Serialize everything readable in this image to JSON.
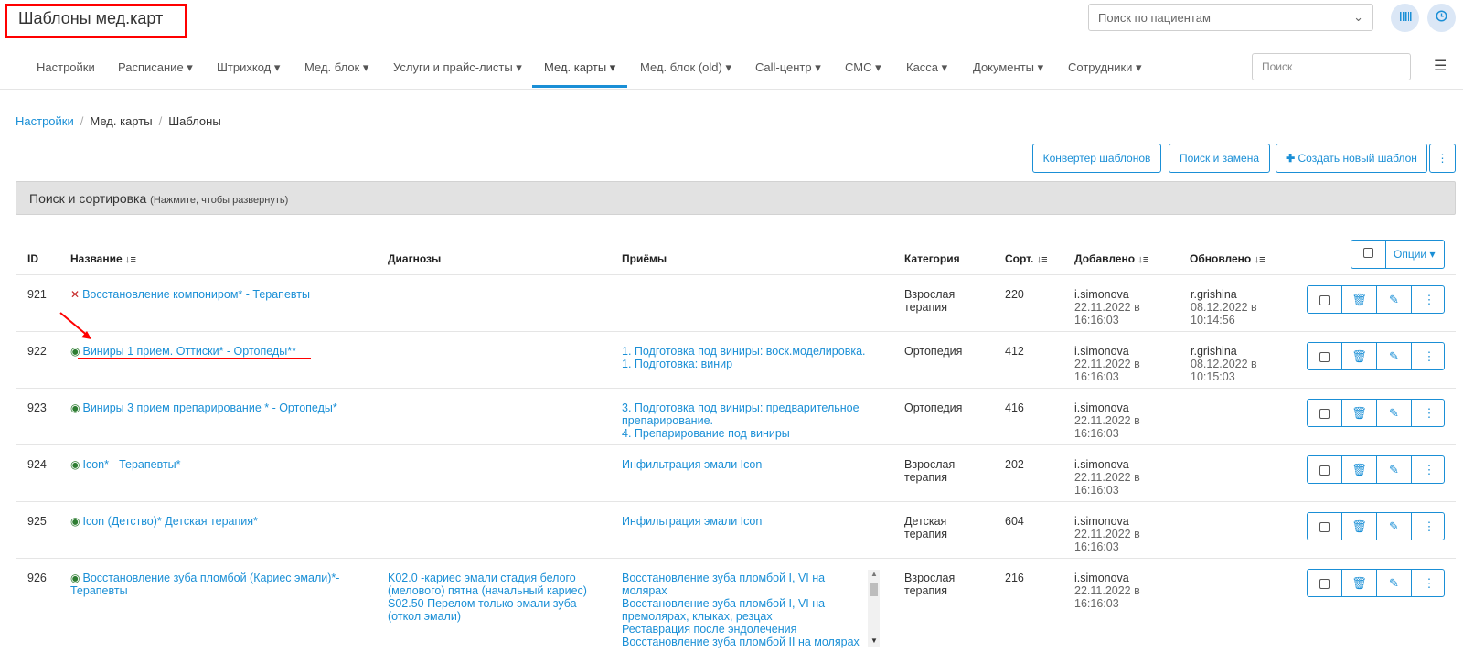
{
  "header": {
    "title": "Шаблоны мед.карт",
    "patient_search_placeholder": "Поиск по пациентам",
    "barcode_icon": "barcode-icon",
    "clock_icon": "clock-icon"
  },
  "nav": {
    "items": [
      {
        "label": "Настройки"
      },
      {
        "label": "Расписание ▾"
      },
      {
        "label": "Штрихкод ▾"
      },
      {
        "label": "Мед. блок ▾"
      },
      {
        "label": "Услуги и прайс-листы ▾"
      },
      {
        "label": "Мед. карты ▾"
      },
      {
        "label": "Мед. блок (old) ▾"
      },
      {
        "label": "Call-центр ▾"
      },
      {
        "label": "СМС ▾"
      },
      {
        "label": "Касса ▾"
      },
      {
        "label": "Документы ▾"
      },
      {
        "label": "Сотрудники ▾"
      }
    ],
    "search_placeholder": "Поиск"
  },
  "breadcrumb": {
    "items": [
      "Настройки",
      "Мед. карты",
      "Шаблоны"
    ]
  },
  "toolbar": {
    "converter_label": "Конвертер шаблонов",
    "search_replace_label": "Поиск и замена",
    "create_label": "Создать новый шаблон"
  },
  "search_panel": {
    "title": "Поиск и сортировка",
    "hint": "(Нажмите, чтобы развернуть)"
  },
  "table": {
    "headers": {
      "id": "ID",
      "name": "Название",
      "diagnoses": "Диагнозы",
      "receptions": "Приёмы",
      "category": "Категория",
      "sort": "Сорт.",
      "added": "Добавлено",
      "updated": "Обновлено"
    },
    "options_label": "Опции",
    "rows": [
      {
        "id": "921",
        "name": "Восстановление компониром* - Терапевты",
        "visible": false,
        "diag": "",
        "rec": "",
        "category": "Взрослая терапия",
        "sort": "220",
        "added_by": "i.simonova",
        "added_date": "22.11.2022 в 16:16:03",
        "updated_by": "r.grishina",
        "updated_date": "08.12.2022 в 10:14:56"
      },
      {
        "id": "922",
        "name": "Виниры 1 прием. Оттиски* - Ортопеды**",
        "visible": true,
        "diag": "",
        "rec": "1. Подготовка под виниры: воск.моделировка.\n1. Подготовка: винир",
        "category": "Ортопедия",
        "sort": "412",
        "added_by": "i.simonova",
        "added_date": "22.11.2022 в 16:16:03",
        "updated_by": "r.grishina",
        "updated_date": "08.12.2022 в 10:15:03"
      },
      {
        "id": "923",
        "name": "Виниры 3 прием препарирование * - Ортопеды*",
        "visible": true,
        "diag": "",
        "rec": "3. Подготовка под виниры: предварительное препарирование.\n4. Препарирование под виниры",
        "category": "Ортопедия",
        "sort": "416",
        "added_by": "i.simonova",
        "added_date": "22.11.2022 в 16:16:03",
        "updated_by": "",
        "updated_date": ""
      },
      {
        "id": "924",
        "name": "Icon* - Терапевты*",
        "visible": true,
        "diag": "",
        "rec": "Инфильтрация эмали Icon",
        "category": "Взрослая терапия",
        "sort": "202",
        "added_by": "i.simonova",
        "added_date": "22.11.2022 в 16:16:03",
        "updated_by": "",
        "updated_date": ""
      },
      {
        "id": "925",
        "name": "Icon (Детство)* Детская терапия*",
        "visible": true,
        "diag": "",
        "rec": "Инфильтрация эмали Icon",
        "category": "Детская терапия",
        "sort": "604",
        "added_by": "i.simonova",
        "added_date": "22.11.2022 в 16:16:03",
        "updated_by": "",
        "updated_date": ""
      },
      {
        "id": "926",
        "name": "Восстановление зуба пломбой (Кариес эмали)*- Терапевты",
        "visible": true,
        "diag": "K02.0 -кариес эмали стадия белого (мелового) пятна (начальный кариес)\nS02.50 Перелом только эмали зуба (откол эмали)",
        "rec": "Восстановление зуба пломбой  I, VI на молярах\nВосстановление зуба пломбой  I, VI на премолярах, клыках, резцах\nРеставрация после эндолечения\nВосстановление зуба пломбой II на молярах",
        "category": "Взрослая терапия",
        "sort": "216",
        "added_by": "i.simonova",
        "added_date": "22.11.2022 в 16:16:03",
        "updated_by": "",
        "updated_date": ""
      }
    ]
  },
  "colors": {
    "accent": "#1a8fd6",
    "annotation": "#ff0000",
    "visible_icon": "#2e7d32",
    "hidden_icon": "#c62828"
  }
}
